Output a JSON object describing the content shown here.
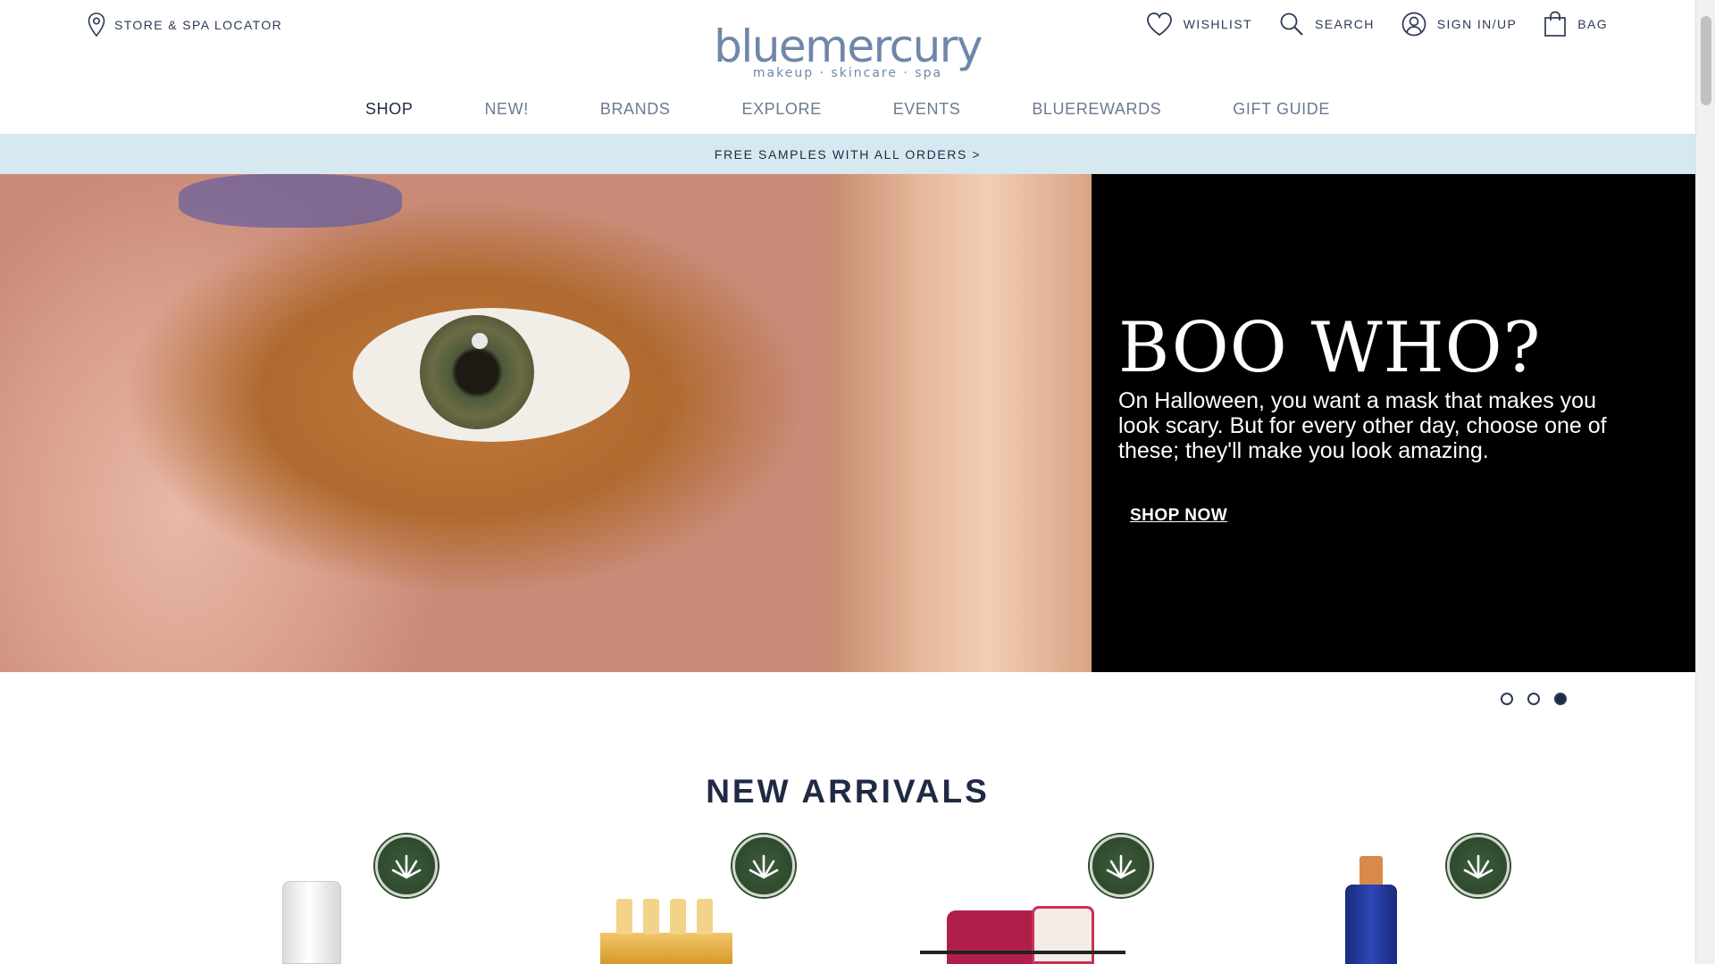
{
  "header": {
    "store_locator": "STORE & SPA LOCATOR",
    "wishlist": "WISHLIST",
    "search": "SEARCH",
    "sign_in": "SIGN IN/UP",
    "bag": "BAG",
    "logo_word": "bluemercury",
    "logo_tagline": "makeup · skincare · spa"
  },
  "nav": {
    "items": [
      "SHOP",
      "NEW!",
      "BRANDS",
      "EXPLORE",
      "EVENTS",
      "BLUEREWARDS",
      "GIFT GUIDE"
    ],
    "active": "SHOP"
  },
  "promo": {
    "text": "FREE SAMPLES WITH ALL ORDERS >"
  },
  "hero": {
    "title": "BOO WHO?",
    "body": "On Halloween, you want a mask that makes you look scary. But for every other day, choose one of these; they'll make you look amazing.",
    "cta": "SHOP NOW"
  },
  "carousel": {
    "slides": 3,
    "active_index": 2
  },
  "new_arrivals": {
    "title": "NEW ARRIVALS"
  },
  "colors": {
    "navy": "#1f2a44",
    "promo_bg": "#d6e9f0",
    "logo_blue": "#6f87a8",
    "badge_green": "#2f4a2e"
  }
}
